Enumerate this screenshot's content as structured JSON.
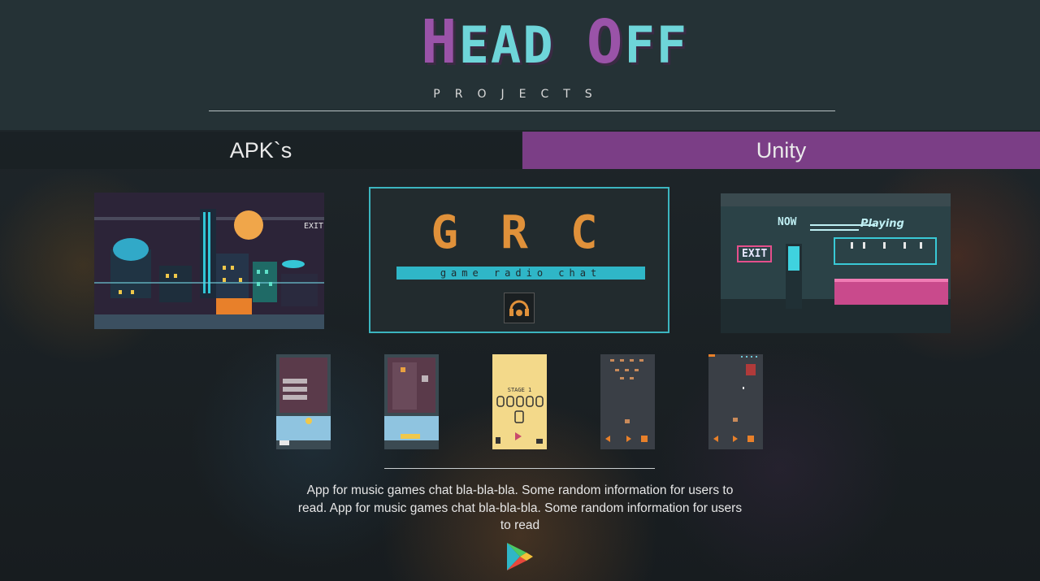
{
  "header": {
    "logo_prefix_big": "H",
    "logo_part1": "EAD ",
    "logo_prefix_big2": "O",
    "logo_part2": "FF",
    "subtitle": "PROJECTS"
  },
  "tabs": [
    {
      "label": "APK`s",
      "active": false
    },
    {
      "label": "Unity",
      "active": true
    }
  ],
  "featured": {
    "city_exit": "EXIT",
    "grc_letters": "GRC",
    "grc_tagline": "game radio chat",
    "bar_now": "NOW",
    "bar_playing": "Playing",
    "bar_exit": "EXIT"
  },
  "thumbnails": {
    "stage_label": "STAGE 1"
  },
  "description": "App for music games chat bla-bla-bla. Some random information for users to read. App for music games chat bla-bla-bla. Some random information for users to read",
  "colors": {
    "header_bg": "#253236",
    "accent_purple": "#7b3e86",
    "logo_cyan": "#6ed5d9",
    "grc_orange": "#e0913a",
    "grc_cyan": "#2fb6c7"
  }
}
